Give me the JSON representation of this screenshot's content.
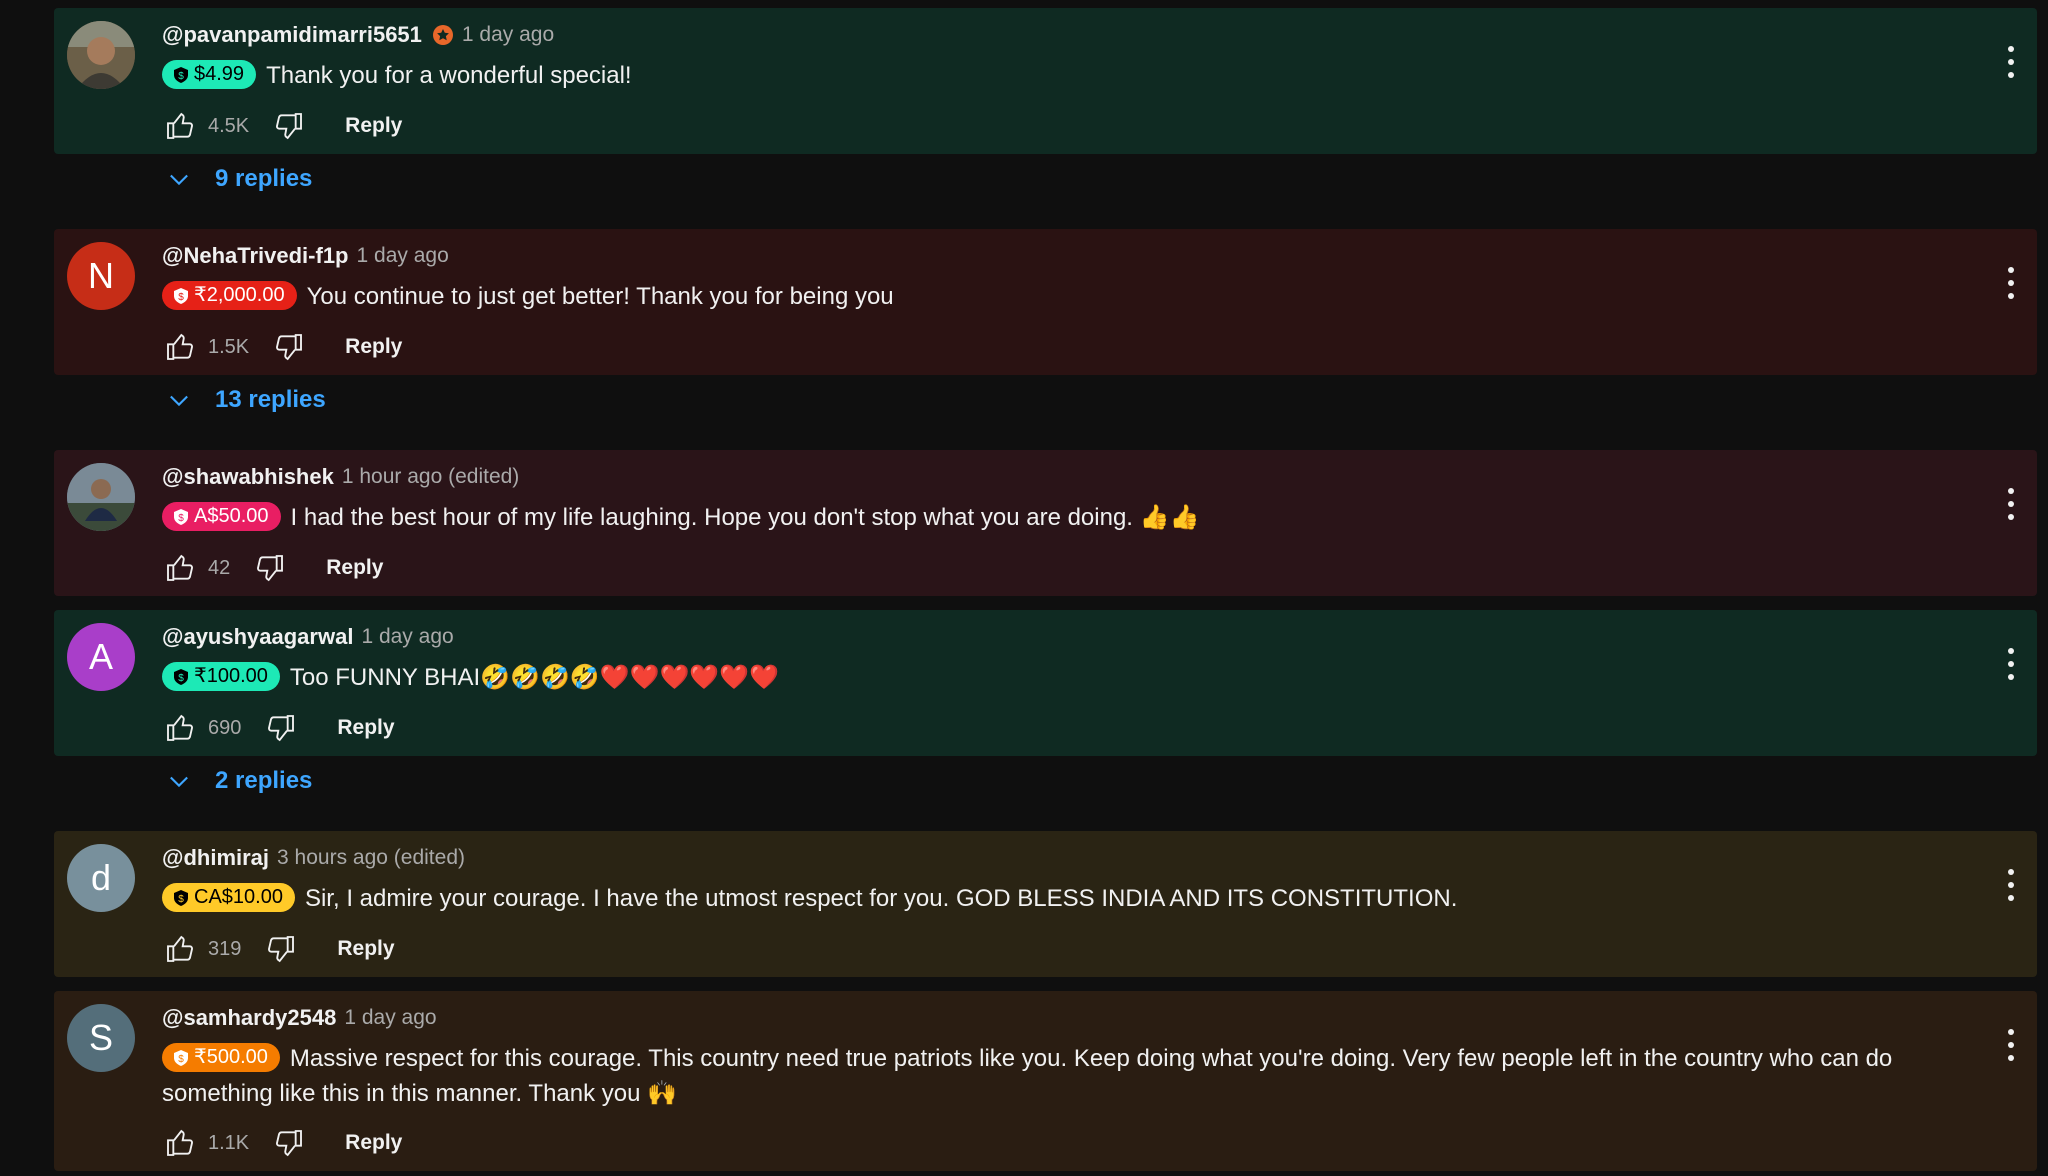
{
  "comments": [
    {
      "author": "@pavanpamidimarri5651",
      "time": "1 day ago",
      "amount": "$4.99",
      "text": "Thank you for a wonderful special!",
      "likes": "4.5K",
      "reply_label": "Reply",
      "bg": "#0f2a22",
      "pill_bg": "#1de9b6",
      "pill_fg": "#000000"
    },
    {
      "author": "@NehaTrivedi-f1p",
      "time": "1 day ago",
      "amount": "₹2,000.00",
      "text": "You continue to just get better! Thank you for being you",
      "likes": "1.5K",
      "reply_label": "Reply",
      "avatar_letter": "N",
      "bg": "#2a1212",
      "pill_bg": "#e62117",
      "pill_fg": "#ffffff"
    },
    {
      "author": "@shawabhishek",
      "time": "1 hour ago (edited)",
      "amount": "A$50.00",
      "text": "I had the best hour of my life laughing. Hope you don't stop what you are doing. 👍👍",
      "likes": "42",
      "reply_label": "Reply",
      "bg": "#2a1418",
      "pill_bg": "#e91e63",
      "pill_fg": "#ffffff"
    },
    {
      "author": "@ayushyaagarwal",
      "time": "1 day ago",
      "amount": "₹100.00",
      "text": "Too FUNNY BHAI🤣🤣🤣🤣❤️❤️❤️❤️❤️❤️",
      "likes": "690",
      "reply_label": "Reply",
      "avatar_letter": "A",
      "bg": "#0f2a22",
      "pill_bg": "#1de9b6",
      "pill_fg": "#000000"
    },
    {
      "author": "@dhimiraj",
      "time": "3 hours ago (edited)",
      "amount": "CA$10.00",
      "text": "Sir, I admire your courage. I have the utmost respect for you. GOD BLESS INDIA AND ITS CONSTITUTION.",
      "likes": "319",
      "reply_label": "Reply",
      "avatar_letter": "d",
      "bg": "#2a2414",
      "pill_bg": "#ffca28",
      "pill_fg": "#000000"
    },
    {
      "author": "@samhardy2548",
      "time": "1 day ago",
      "amount": "₹500.00",
      "text": "Massive respect for this courage. This country need true patriots like you. Keep doing what you're doing. Very few people left in the country who can do something like this in this manner. Thank you 🙌",
      "likes": "1.1K",
      "reply_label": "Reply",
      "avatar_letter": "S",
      "bg": "#2a1d12",
      "pill_bg": "#f57c00",
      "pill_fg": "#ffffff"
    }
  ],
  "reply_toggles": [
    {
      "label": "9 replies"
    },
    {
      "label": "13 replies"
    },
    {
      "label": "2 replies"
    }
  ],
  "colors": {
    "page_bg": "#0f0f0f",
    "link_blue": "#3ea6ff",
    "avatar_N": "#c62d17",
    "avatar_A": "#a93ec9",
    "avatar_d": "#78909c",
    "avatar_S": "#546e7a"
  },
  "icons": [
    "thumbs-up-icon",
    "thumbs-down-icon",
    "more-vert-icon",
    "chevron-down-icon",
    "super-chat-coin-icon",
    "member-star-icon"
  ]
}
